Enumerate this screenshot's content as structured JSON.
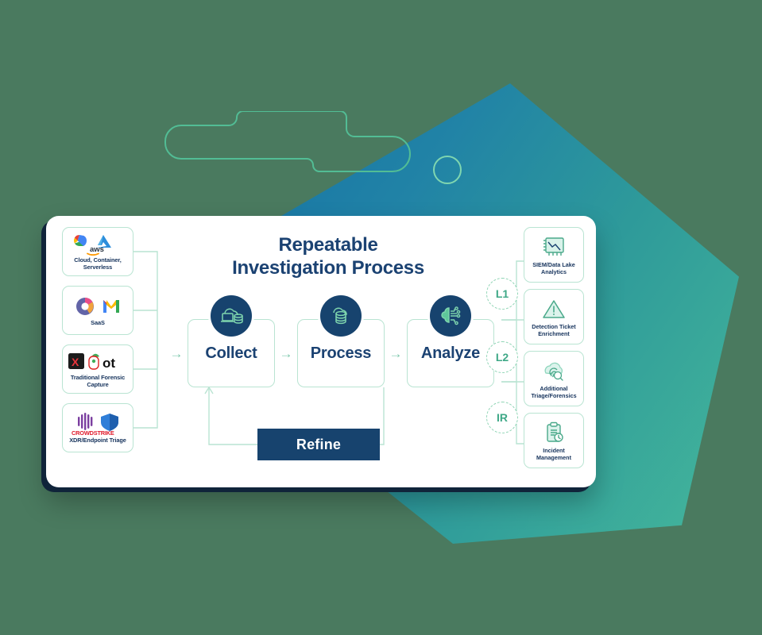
{
  "diagram": {
    "title_line1": "Repeatable",
    "title_line2": "Investigation Process",
    "refine_label": "Refine",
    "sources": [
      {
        "label": "Cloud, Container, Serverless",
        "icons": [
          "google-cloud-logo",
          "azure-logo",
          "aws-logo"
        ]
      },
      {
        "label": "SaaS",
        "icons": [
          "microsoft-365-logo",
          "gmail-logo"
        ]
      },
      {
        "label": "Traditional Forensic Capture",
        "icons": [
          "magnet-axiom-logo",
          "volatility-logo",
          "opentext-logo"
        ]
      },
      {
        "label": "XDR/Endpoint Triage",
        "icons": [
          "crowdstrike-logo",
          "microsoft-defender-logo"
        ]
      }
    ],
    "steps": [
      {
        "name": "Collect",
        "icon": "cloud-laptop-database-icon"
      },
      {
        "name": "Process",
        "icon": "cloud-database-icon"
      },
      {
        "name": "Analyze",
        "icon": "ai-brain-circuit-icon"
      }
    ],
    "arrows": [
      "→",
      "→",
      "→",
      "→",
      "→"
    ],
    "tiers": [
      {
        "label": "L1"
      },
      {
        "label": "L2"
      },
      {
        "label": "IR"
      }
    ],
    "outputs": [
      {
        "label": "SIEM/Data Lake Analytics",
        "icon": "line-chart-icon"
      },
      {
        "label": "Detection Ticket Enrichment",
        "icon": "warning-triangle-icon"
      },
      {
        "label": "Additional Triage/Forensics",
        "icon": "cloud-fingerprint-search-icon"
      },
      {
        "label": "Incident Management",
        "icon": "clipboard-clock-icon"
      }
    ],
    "colors": {
      "navy": "#17436e",
      "title_navy": "#1b4272",
      "mint_border": "#b9e4d2",
      "tier_green": "#3fa887",
      "background_green": "#4a7a5f",
      "blob_blue": "#1673a6",
      "blob_teal": "#45b79b"
    }
  }
}
